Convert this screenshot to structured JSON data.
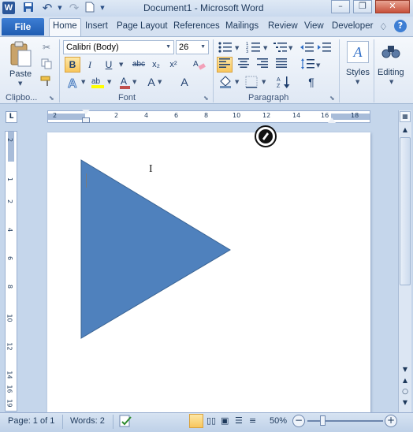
{
  "app": {
    "title": "Document1 - Microsoft Word"
  },
  "tabs": {
    "file": "File",
    "home": "Home",
    "insert": "Insert",
    "page_layout": "Page Layout",
    "references": "References",
    "mailings": "Mailings",
    "review": "Review",
    "view": "View",
    "developer": "Developer"
  },
  "clipboard": {
    "paste_label": "Paste",
    "group_label": "Clipbo..."
  },
  "font": {
    "name": "Calibri (Body)",
    "size": "26",
    "group_label": "Font",
    "bold": "B",
    "italic": "I",
    "underline": "U",
    "strike": "abc",
    "subscript": "x₂",
    "superscript": "x²",
    "grow": "A",
    "case": "Aa"
  },
  "paragraph": {
    "group_label": "Paragraph",
    "pilcrow": "¶"
  },
  "styles": {
    "label": "Styles",
    "glyph": "A"
  },
  "editing": {
    "label": "Editing"
  },
  "ruler": {
    "top_numbers": [
      "2",
      "2",
      "4",
      "6",
      "8",
      "10",
      "12",
      "14",
      "16",
      "18"
    ],
    "side_numbers": [
      "2",
      "1",
      "2",
      "4",
      "6",
      "8",
      "10",
      "12",
      "14",
      "16",
      "19"
    ]
  },
  "status": {
    "page": "Page: 1 of 1",
    "words": "Words: 2",
    "zoom": "50%"
  },
  "colors": {
    "shape_fill": "#4f81bd",
    "shape_stroke": "#3a6494",
    "accent": "#1f5cb1"
  },
  "icons": [
    "word-logo-icon",
    "save-icon",
    "undo-icon",
    "redo-icon",
    "new-document-icon",
    "minimize-icon",
    "restore-icon",
    "close-icon",
    "help-icon",
    "paste-icon",
    "cut-icon",
    "copy-icon",
    "format-painter-icon",
    "styles-icon",
    "editing-icon",
    "drag-handle-icon",
    "proofing-icon",
    "zoom-out-icon",
    "zoom-in-icon"
  ]
}
